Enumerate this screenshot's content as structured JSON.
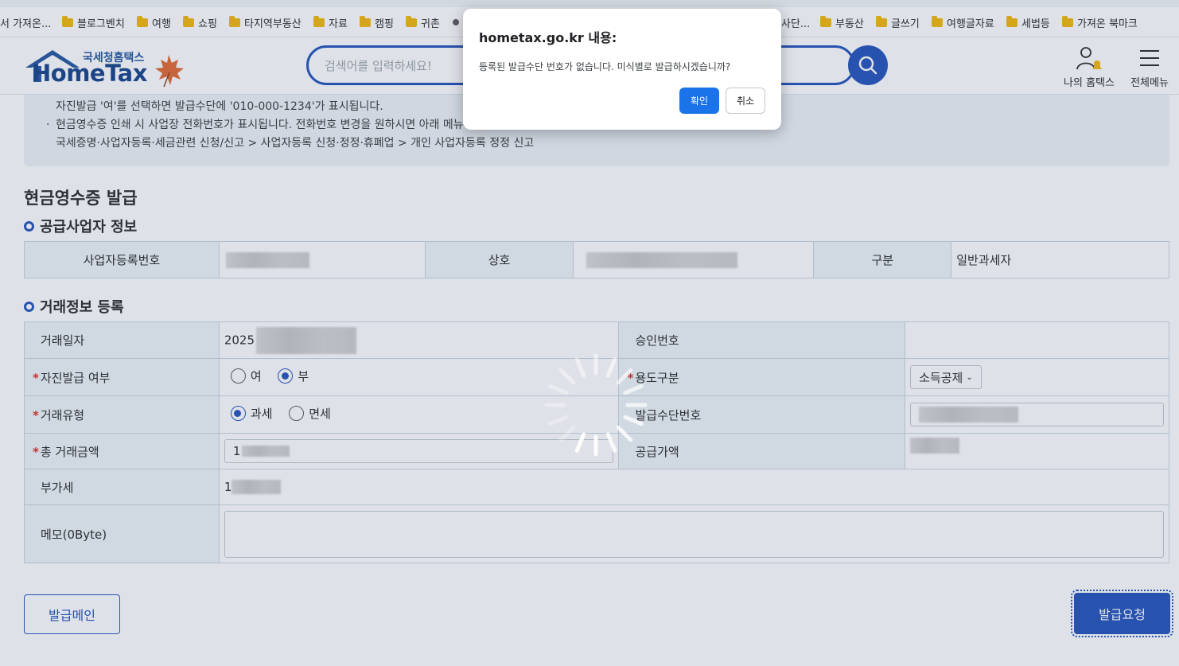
{
  "bookmarks": [
    {
      "label": "서 가져온...",
      "folder": false
    },
    {
      "label": "블로그벤치",
      "folder": true
    },
    {
      "label": "여행",
      "folder": true
    },
    {
      "label": "쇼핑",
      "folder": true
    },
    {
      "label": "타지역부동산",
      "folder": true
    },
    {
      "label": "자료",
      "folder": true
    },
    {
      "label": "캠핑",
      "folder": true
    },
    {
      "label": "귀촌",
      "folder": true
    },
    {
      "label": "사단...",
      "folder": false
    },
    {
      "label": "부동산",
      "folder": true
    },
    {
      "label": "글쓰기",
      "folder": true
    },
    {
      "label": "여행글자료",
      "folder": true
    },
    {
      "label": "세법등",
      "folder": true
    },
    {
      "label": "가져온 북마크",
      "folder": true
    }
  ],
  "header": {
    "logo_sub": "국세청홈택스",
    "logo_main": "HomeTax",
    "search_placeholder": "검색어를 입력하세요!",
    "my_hometax": "나의 홈택스",
    "all_menu": "전체메뉴"
  },
  "notice": {
    "line1": "자진발급 '여'를 선택하면 발급수단에 '010-000-1234'가 표시됩니다.",
    "line2": "현금영수증 인쇄 시 사업장 전화번호가 표시됩니다. 전화번호 변경을 원하시면 아래 메뉴",
    "line3": "국세증명·사업자등록·세금관련 신청/신고 > 사업자등록 신청·정정·휴폐업 > 개인 사업자등록 정정 신고"
  },
  "page_title": "현금영수증 발급",
  "supplier": {
    "title": "공급사업자 정보",
    "biz_no_label": "사업자등록번호",
    "name_label": "상호",
    "type_label": "구분",
    "type_value": "일반과세자"
  },
  "transaction": {
    "title": "거래정보 등록",
    "date_label": "거래일자",
    "date_value": "2025",
    "approval_label": "승인번호",
    "self_issue_label": "자진발급 여부",
    "self_issue_yes": "여",
    "self_issue_no": "부",
    "usage_label": "용도구분",
    "usage_value": "소득공제",
    "type_label": "거래유형",
    "type_taxable": "과세",
    "type_exempt": "면세",
    "means_label": "발급수단번호",
    "total_label": "총 거래금액",
    "total_value": "1",
    "supply_label": "공급가액",
    "vat_label": "부가세",
    "vat_value": "1",
    "memo_label": "메모(0Byte)"
  },
  "buttons": {
    "issue_main": "발급메인",
    "issue_request": "발급요청"
  },
  "dialog": {
    "title": "hometax.go.kr 내용:",
    "message": "등록된 발급수단 번호가 없습니다. 미식별로 발급하시겠습니까?",
    "ok": "확인",
    "cancel": "취소"
  },
  "colors": {
    "brand_blue": "#1c4bb8",
    "dialog_ok": "#1a73e8"
  }
}
